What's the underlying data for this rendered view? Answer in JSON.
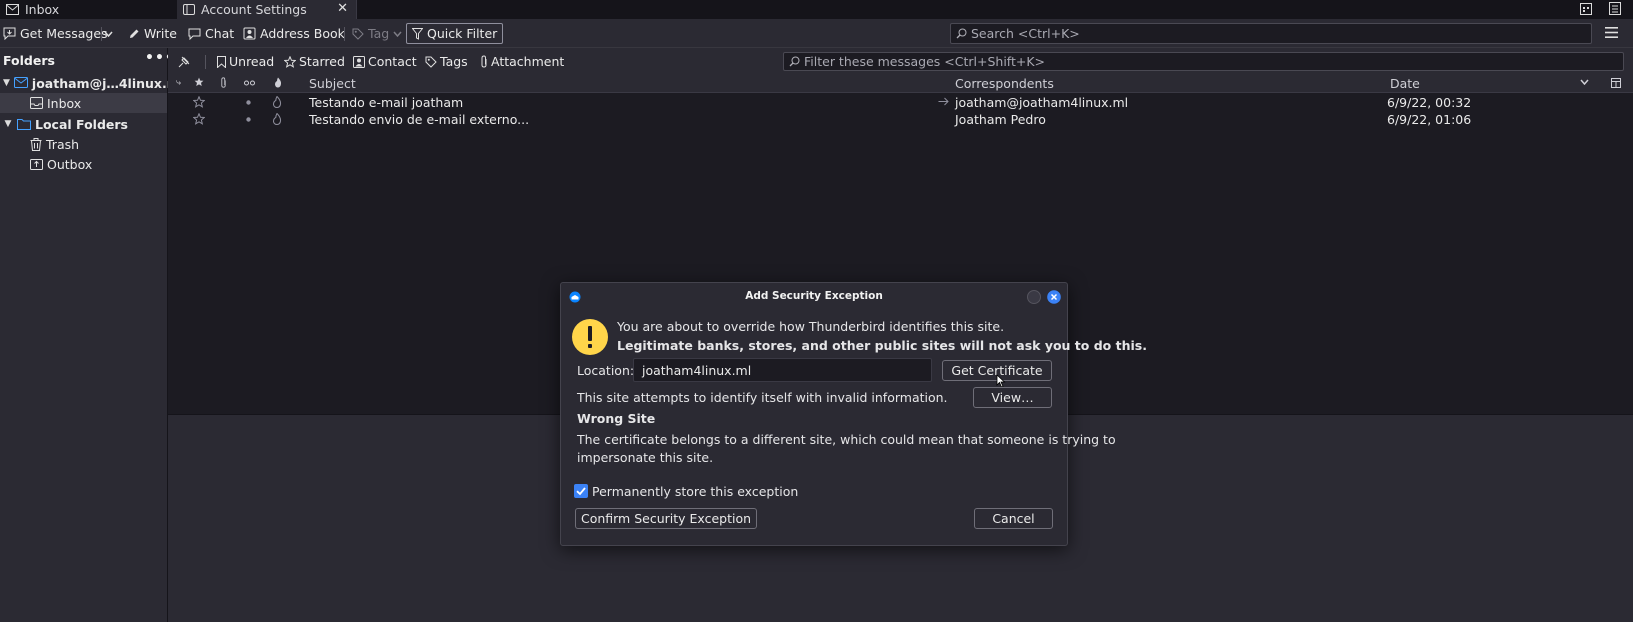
{
  "tabs": [
    {
      "label": "Inbox",
      "icon": "envelope-icon"
    },
    {
      "label": "Account Settings",
      "icon": "settings-panel-icon"
    }
  ],
  "toolbar": {
    "get_messages": "Get Messages",
    "write": "Write",
    "chat": "Chat",
    "address_book": "Address Book",
    "tag": "Tag",
    "quick_filter": "Quick Filter",
    "search_placeholder": "Search <Ctrl+K>"
  },
  "sidebar": {
    "header": "Folders",
    "more": "•••",
    "account": "joatham@j…4linux.ml",
    "inbox": "Inbox",
    "local_folders": "Local Folders",
    "trash": "Trash",
    "outbox": "Outbox"
  },
  "quick_filter": {
    "unread": "Unread",
    "starred": "Starred",
    "contact": "Contact",
    "tags": "Tags",
    "attachment": "Attachment",
    "filter_placeholder": "Filter these messages <Ctrl+Shift+K>"
  },
  "columns": {
    "subject": "Subject",
    "correspondents": "Correspondents",
    "date": "Date"
  },
  "messages": [
    {
      "subject": "Testando e-mail joatham",
      "correspondent": "joatham@joatham4linux.ml",
      "date": "6/9/22, 00:32",
      "outgoing": true
    },
    {
      "subject": "Testando envio de e-mail externo...",
      "correspondent": "Joatham Pedro",
      "date": "6/9/22, 01:06",
      "outgoing": false
    }
  ],
  "dialog": {
    "title": "Add Security Exception",
    "warning_line1": "You are about to override how Thunderbird identifies this site.",
    "warning_line2": "Legitimate banks, stores, and other public sites will not ask you to do this.",
    "location_label": "Location:",
    "location_value": "joatham4linux.ml",
    "get_certificate": "Get Certificate",
    "status_text": "This site attempts to identify itself with invalid information.",
    "view_button": "View…",
    "wrong_site_title": "Wrong Site",
    "wrong_site_line1": "The certificate belongs to a different site, which could mean that someone is trying to",
    "wrong_site_line2": "impersonate this site.",
    "permanent_label": "Permanently store this exception",
    "permanent_checked": true,
    "confirm_button": "Confirm Security Exception",
    "cancel_button": "Cancel"
  },
  "colors": {
    "accent": "#0061e0",
    "warning_yellow": "#ffd54a",
    "folder_blue": "#45a1ff"
  }
}
